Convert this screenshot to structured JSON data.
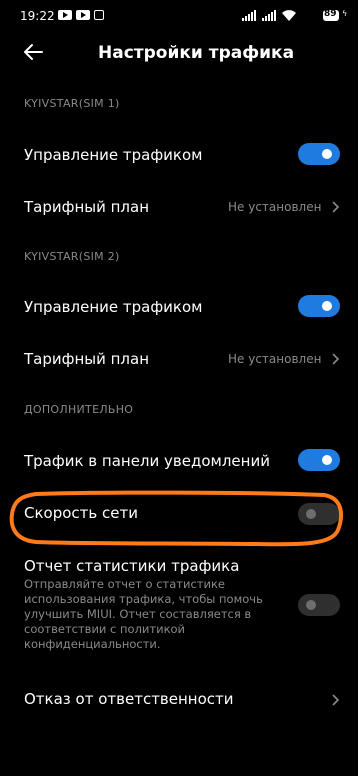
{
  "status_bar": {
    "time": "19:22",
    "battery": "89"
  },
  "header": {
    "title": "Настройки трафика"
  },
  "sim1": {
    "section": "KYIVSTAR(SIM 1)",
    "traffic_control": {
      "label": "Управление трафиком",
      "on": true
    },
    "tariff": {
      "label": "Тарифный план",
      "value": "Не установлен"
    }
  },
  "sim2": {
    "section": "KYIVSTAR(SIM 2)",
    "traffic_control": {
      "label": "Управление трафиком",
      "on": true
    },
    "tariff": {
      "label": "Тарифный план",
      "value": "Не установлен"
    }
  },
  "extra": {
    "section": "ДОПОЛНИТЕЛЬНО",
    "notify_traffic": {
      "label": "Трафик в панели уведомлений",
      "on": true
    },
    "net_speed": {
      "label": "Скорость сети",
      "on": false
    },
    "stats_report": {
      "label": "Отчет статистики трафика",
      "desc": "Отправляйте отчет о статистике использования трафика, чтобы помочь улучшить MIUI. Отчет составляется в соответствии с политикой конфиденциальности.",
      "on": false
    },
    "disclaimer": {
      "label": "Отказ от ответственности"
    }
  },
  "colors": {
    "accent": "#1f7be0",
    "annotation": "#ff7a1a",
    "background": "#000000"
  }
}
